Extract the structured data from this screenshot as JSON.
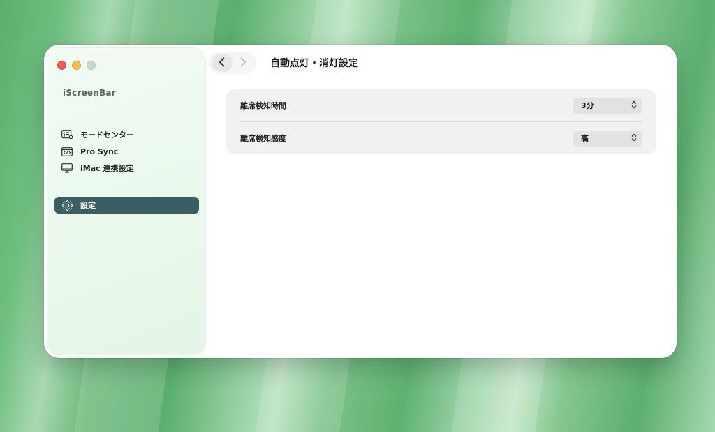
{
  "app": {
    "name": "iScreenBar"
  },
  "sidebar": {
    "items": [
      {
        "label": "モードセンター",
        "icon": "mode-center-icon"
      },
      {
        "label": "Pro Sync",
        "icon": "code-window-icon"
      },
      {
        "label": "iMac 連携設定",
        "icon": "monitor-icon"
      }
    ],
    "settings": {
      "label": "設定",
      "icon": "gear-icon",
      "active": true
    }
  },
  "toolbar": {
    "back_icon": "chevron-left-icon",
    "forward_icon": "chevron-right-icon"
  },
  "page": {
    "title": "自動点灯・消灯設定"
  },
  "settings_rows": [
    {
      "label": "離席検知時間",
      "value": "3分"
    },
    {
      "label": "離席検知感度",
      "value": "高"
    }
  ],
  "colors": {
    "active_item_bg": "#3a5f63",
    "close": "#ee5f57",
    "minimize": "#f4bd4f"
  }
}
